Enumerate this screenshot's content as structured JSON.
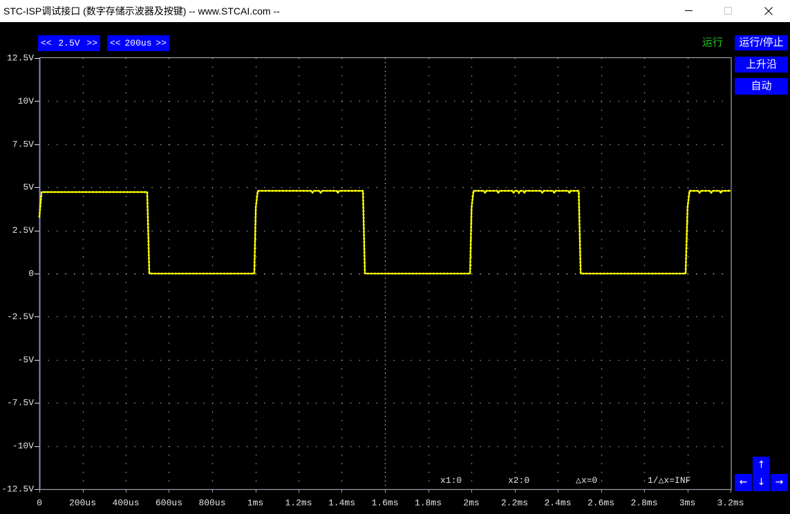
{
  "window": {
    "title": "STC-ISP调试接口 (数字存储示波器及按键) -- www.STCAI.com --",
    "controls": [
      "minimize-icon",
      "maximize-icon",
      "close-icon"
    ]
  },
  "colors": {
    "background": "#000000",
    "button": "#0000ff",
    "button_text": "#ffffff",
    "signal": "#ffff00",
    "status_running": "#22c322",
    "grid": "#b0b0b0",
    "grid_center": "#d6d6d6",
    "frame": "#a6a6b4",
    "frame_left": "#8a86c8",
    "label": "#e6e6e6"
  },
  "scale_controls": {
    "volts_per_div": {
      "dec": "<<",
      "value": "2.5V",
      "inc": ">>"
    },
    "time_per_div": {
      "dec": "<<",
      "value": "200us",
      "inc": ">>"
    }
  },
  "status": "运行",
  "side_buttons": {
    "run_stop": "运行/停止",
    "trigger_edge": "上升沿",
    "auto": "自动"
  },
  "cursor_readouts": {
    "x1": "x1:0",
    "x2": "x2:0",
    "dx": "△x=0",
    "inv_dx": "1/△x=INF"
  },
  "nav_buttons": {
    "up": {
      "icon": "arrow-up-icon",
      "glyph": "↑"
    },
    "left": {
      "icon": "arrow-left-icon",
      "glyph": "←"
    },
    "down": {
      "icon": "arrow-down-icon",
      "glyph": "↓"
    },
    "right": {
      "icon": "arrow-right-icon",
      "glyph": "→"
    }
  },
  "chart_data": {
    "type": "line",
    "grid": true,
    "xlim": [
      0,
      3.2
    ],
    "ylim": [
      -12.5,
      12.5
    ],
    "x_ticks": [
      {
        "value": 0,
        "label": "0"
      },
      {
        "value": 0.2,
        "label": "200us"
      },
      {
        "value": 0.4,
        "label": "400us"
      },
      {
        "value": 0.6,
        "label": "600us"
      },
      {
        "value": 0.8,
        "label": "800us"
      },
      {
        "value": 1.0,
        "label": "1ms"
      },
      {
        "value": 1.2,
        "label": "1.2ms"
      },
      {
        "value": 1.4,
        "label": "1.4ms"
      },
      {
        "value": 1.6,
        "label": "1.6ms"
      },
      {
        "value": 1.8,
        "label": "1.8ms"
      },
      {
        "value": 2.0,
        "label": "2ms"
      },
      {
        "value": 2.2,
        "label": "2.2ms"
      },
      {
        "value": 2.4,
        "label": "2.4ms"
      },
      {
        "value": 2.6,
        "label": "2.6ms"
      },
      {
        "value": 2.8,
        "label": "2.8ms"
      },
      {
        "value": 3.0,
        "label": "3ms"
      },
      {
        "value": 3.2,
        "label": "3.2ms"
      }
    ],
    "y_ticks": [
      {
        "value": 12.5,
        "label": "12.5V"
      },
      {
        "value": 10,
        "label": "10V"
      },
      {
        "value": 7.5,
        "label": "7.5V"
      },
      {
        "value": 5,
        "label": "5V"
      },
      {
        "value": 2.5,
        "label": "2.5V"
      },
      {
        "value": 0,
        "label": "0"
      },
      {
        "value": -2.5,
        "label": "-2.5V"
      },
      {
        "value": -5,
        "label": "-5V"
      },
      {
        "value": -7.5,
        "label": "-7.5V"
      },
      {
        "value": -10,
        "label": "-10V"
      },
      {
        "value": -12.5,
        "label": "-12.5V"
      }
    ],
    "series": [
      {
        "color": "#ffff00",
        "x": [
          0,
          0.01,
          0.499,
          0.509,
          0.995,
          1.002,
          1.011,
          1.258,
          1.264,
          1.27,
          1.296,
          1.302,
          1.308,
          1.376,
          1.382,
          1.388,
          1.498,
          1.507,
          1.994,
          2.001,
          2.01,
          2.058,
          2.064,
          2.07,
          2.118,
          2.124,
          2.13,
          2.189,
          2.195,
          2.201,
          2.214,
          2.22,
          2.226,
          2.24,
          2.246,
          2.252,
          2.323,
          2.329,
          2.335,
          2.378,
          2.384,
          2.39,
          2.448,
          2.454,
          2.46,
          2.497,
          2.506,
          2.992,
          3.001,
          3.01,
          3.05,
          3.056,
          3.062,
          3.104,
          3.11,
          3.116,
          3.149,
          3.155,
          3.161,
          3.2
        ],
        "y": [
          3.3,
          4.73,
          4.73,
          0,
          0,
          3.85,
          4.8,
          4.8,
          4.68,
          4.8,
          4.8,
          4.68,
          4.8,
          4.8,
          4.68,
          4.8,
          4.8,
          0,
          0,
          3.85,
          4.8,
          4.8,
          4.68,
          4.8,
          4.8,
          4.68,
          4.8,
          4.8,
          4.68,
          4.8,
          4.8,
          4.68,
          4.8,
          4.8,
          4.68,
          4.8,
          4.8,
          4.68,
          4.8,
          4.8,
          4.68,
          4.8,
          4.8,
          4.68,
          4.8,
          4.8,
          0,
          0,
          3.85,
          4.8,
          4.8,
          4.68,
          4.8,
          4.8,
          4.68,
          4.8,
          4.8,
          4.68,
          4.8,
          4.8
        ]
      }
    ]
  }
}
